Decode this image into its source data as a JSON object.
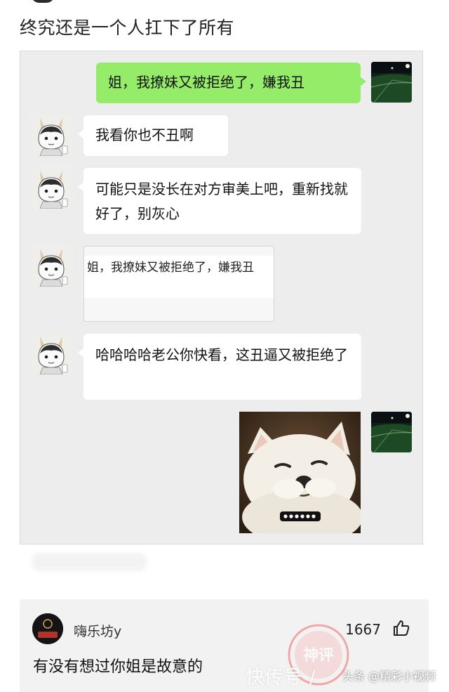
{
  "post": {
    "title": "终究还是一个人扛下了所有"
  },
  "chat": {
    "msg1": "姐，我撩妹又被拒绝了，嫌我丑",
    "msg2": "我看你也不丑啊",
    "msg3": "可能只是没长在对方审美上吧，重新找就好了，别灰心",
    "quote": "姐，我撩妹又被拒绝了，嫌我丑",
    "msg4": "哈哈哈哈老公你快看，这丑逼又被拒绝了",
    "sticker_caption": "……"
  },
  "comment": {
    "user": "嗨乐坊y",
    "avatar_logo": "嗨乐坊",
    "likes": "1667",
    "text": "有没有想过你姐是故意的",
    "stamp_text": "神评"
  },
  "watermark": {
    "app": "快传号 /",
    "source": "头条 @精彩小视频"
  }
}
